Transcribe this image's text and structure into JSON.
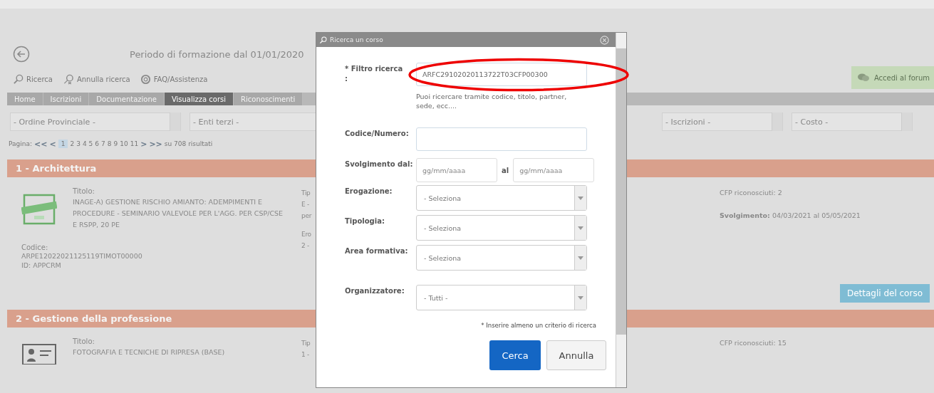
{
  "page": {
    "title": "Periodo di formazione dal 01/01/2020",
    "toolbar": [
      {
        "label": "Ricerca",
        "kind": "search"
      },
      {
        "label": "Annulla ricerca",
        "kind": "cancel"
      },
      {
        "label": "FAQ/Assistenza",
        "kind": "help"
      }
    ],
    "forum_button": "Accedi al forum",
    "tabs": [
      {
        "label": "Home",
        "selected": false
      },
      {
        "label": "Iscrizioni",
        "selected": false
      },
      {
        "label": "Documentazione",
        "selected": false
      },
      {
        "label": "Visualizza corsi",
        "selected": true
      },
      {
        "label": "Riconoscimenti",
        "selected": false
      }
    ],
    "filters_left": [
      "- Ordine Provinciale -",
      "- Enti terzi -"
    ],
    "filters_right": [
      "- Iscrizioni -",
      "- Costo -"
    ],
    "pagination": {
      "label": "Pagina:",
      "first": "<<",
      "prev": "<",
      "pages": [
        {
          "label": "1",
          "selected": true
        },
        {
          "label": "2",
          "selected": false
        },
        {
          "label": "3",
          "selected": false
        },
        {
          "label": "4",
          "selected": false
        },
        {
          "label": "5",
          "selected": false
        },
        {
          "label": "6",
          "selected": false
        },
        {
          "label": "7",
          "selected": false
        },
        {
          "label": "8",
          "selected": false
        },
        {
          "label": "9",
          "selected": false
        },
        {
          "label": "10",
          "selected": false
        },
        {
          "label": "11",
          "selected": false
        }
      ],
      "next": ">",
      "last": ">>",
      "summary": "su 708 risultati"
    },
    "sections": [
      {
        "header": "1 - Architettura",
        "course": {
          "title_label": "Titolo:",
          "title": "INAGE-A) GESTIONE RISCHIO AMIANTO: ADEMPIMENTI E PROCEDURE - SEMINARIO VALEVOLE PER L'AGG. PER CSP/CSE E RSPP, 20 PE",
          "code_label": "Codice:",
          "code": "ARPE12022021125119TIMOT00000",
          "id": "ID: APPCRM",
          "column_2": [
            "Tip",
            "E -",
            "per",
            "Ero",
            "2 -"
          ],
          "cfp": "CFP riconosciuti: 2",
          "svolgimento": "**Svolgimento:** 04/03/2021 al 05/05/2021",
          "details_button": "Dettagli del corso"
        }
      },
      {
        "header": "2 - Gestione della professione",
        "course": {
          "title_label": "Titolo:",
          "title": "FOTOGRAFIA E TECNICHE DI RIPRESA (BASE)",
          "column_2": [
            "Tip",
            "1 -"
          ],
          "cfp": "CFP riconosciuti: 15"
        }
      }
    ]
  },
  "modal": {
    "title": "Ricerca un corso",
    "fields": [
      {
        "kind": "text",
        "label": "* Filtro ricerca :",
        "value": "ARFC29102020113722T03CFP00300",
        "hint": "Puoi ricercare tramite codice, titolo, partner, sede, ecc...."
      },
      {
        "kind": "text",
        "label": "Codice/Numero:"
      },
      {
        "kind": "daterange",
        "label": "Svolgimento dal:",
        "from_placeholder": "gg/mm/aaaa",
        "separator": "al",
        "to_placeholder": "gg/mm/aaaa"
      },
      {
        "kind": "select",
        "label": "Erogazione:",
        "value": "- Seleziona"
      },
      {
        "kind": "select",
        "label": "Tipologia:",
        "value": "- Seleziona"
      },
      {
        "kind": "select",
        "label": "Area formativa:",
        "value": "- Seleziona"
      },
      {
        "kind": "select",
        "label": "Organizzatore:",
        "value": "- Tutti -"
      }
    ],
    "note": "* Inserire almeno un criterio di ricerca",
    "buttons": [
      {
        "label": "Cerca",
        "kind": "primary"
      },
      {
        "label": "Annulla",
        "kind": "secondary"
      }
    ]
  }
}
